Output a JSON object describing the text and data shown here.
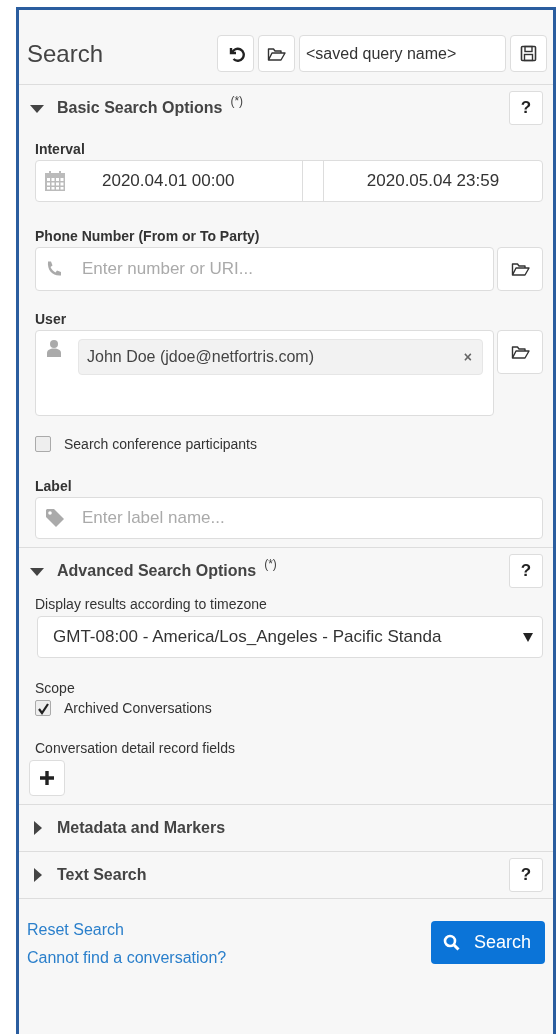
{
  "title": "Search",
  "saved_query": {
    "placeholder": "<saved query name>"
  },
  "sections": [
    {
      "kind": "basic",
      "title": "Basic Search Options",
      "mark": "(*)",
      "expanded": true,
      "help": "?",
      "interval": {
        "label": "Interval",
        "from": "2020.04.01 00:00",
        "to": "2020.05.04 23:59"
      },
      "phone": {
        "label": "Phone Number (From or To Party)",
        "placeholder": "Enter number or URI..."
      },
      "user": {
        "label": "User",
        "chips": [
          {
            "text": "John Doe (jdoe@netfortris.com)",
            "remove": "×"
          }
        ]
      },
      "conference": {
        "label": "Search conference participants",
        "checked": false
      },
      "label_field": {
        "label": "Label",
        "placeholder": "Enter label name..."
      }
    },
    {
      "kind": "advanced",
      "title": "Advanced Search Options",
      "mark": "(*)",
      "expanded": true,
      "help": "?",
      "timezone": {
        "label": "Display results according to timezone",
        "value": "GMT-08:00 - America/Los_Angeles - Pacific Standa"
      },
      "scope": {
        "label": "Scope",
        "options": [
          {
            "label": "Archived Conversations",
            "checked": true
          }
        ]
      },
      "cdr": {
        "label": "Conversation detail record fields"
      }
    },
    {
      "kind": "plain",
      "title": "Metadata and Markers",
      "expanded": false
    },
    {
      "kind": "plain",
      "title": "Text Search",
      "expanded": false,
      "help": "?"
    }
  ],
  "footer": {
    "links": [
      "Reset Search",
      "Cannot find a conversation?"
    ],
    "button": "Search"
  }
}
